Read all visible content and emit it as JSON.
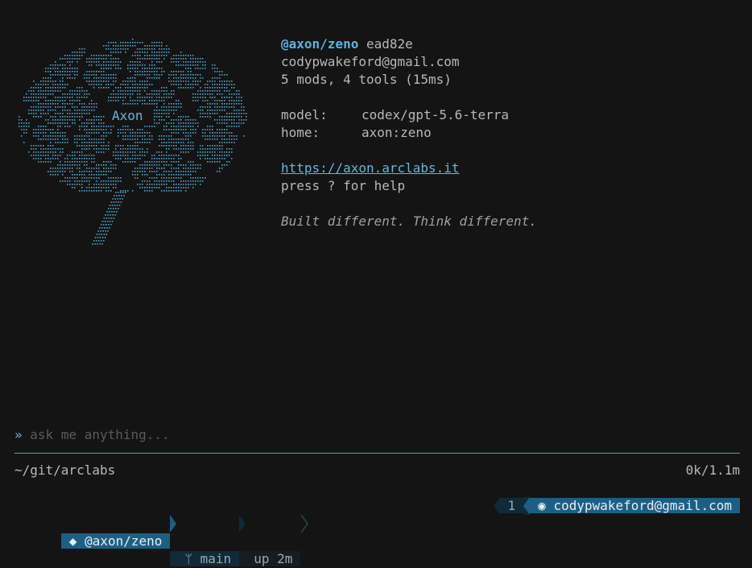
{
  "logo": {
    "label": "Axon"
  },
  "info": {
    "handle": "@axon/zeno",
    "commit": "ead82e",
    "email": "codypwakeford@gmail.com",
    "stats": "5 mods, 4 tools (15ms)",
    "model_key": "model:",
    "model_value": "codex/gpt-5.6-terra",
    "home_key": "home:",
    "home_value": "axon:zeno",
    "url": "https://axon.arclabs.it",
    "help": "press ? for help",
    "tagline": "Built different. Think different."
  },
  "prompt": {
    "symbol": "»",
    "placeholder": "ask me anything..."
  },
  "footer": {
    "cwd": "~/git/arclabs",
    "tokens": "0k/1.1m"
  },
  "statusbar": {
    "user_icon": "◆",
    "user": "@axon/zeno",
    "branch_icon": "ᛘ",
    "branch": "main",
    "uptime": "up 2m",
    "count": "1",
    "email_icon": "◉",
    "email": "codypwakeford@gmail.com"
  },
  "colors": {
    "accent": "#5cb8d8",
    "bg": "#141414",
    "status_blue": "#1d5f84"
  },
  "icons": [
    "brain-logo-icon",
    "diamond-icon",
    "git-branch-icon",
    "circle-icon"
  ]
}
